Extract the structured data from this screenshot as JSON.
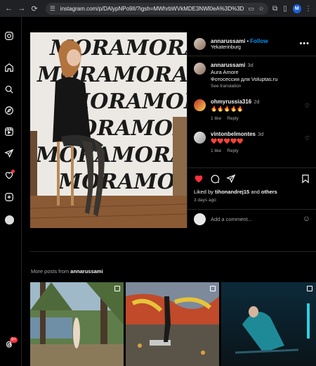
{
  "browser": {
    "url": "instagram.com/p/DAlypNPo9Il/?igsh=MWhrbWVkMDE3NWl0eA%3D%3D",
    "profile_initial": "M"
  },
  "post": {
    "username": "annarussami",
    "follow_label": "Follow",
    "separator": "•",
    "location": "Yekaterinburg",
    "photo_text": "MORAMORA",
    "caption": {
      "username": "annarussami",
      "time": "3d",
      "lines": [
        "Aura Amore",
        "Фотосессия для Voluptas.ru"
      ],
      "see_translation": "See translation"
    },
    "comments": [
      {
        "username": "ohmyrussia316",
        "time": "2d",
        "text": "🔥🔥🔥🔥🔥",
        "likes": "1 like",
        "reply": "Reply"
      },
      {
        "username": "vintonbelmontes",
        "time": "3d",
        "text": "❤️❤️❤️❤️❤️",
        "likes": "1 like",
        "reply": "Reply"
      }
    ],
    "liked_by_prefix": "Liked by",
    "liked_by_user": "tihonandrej15",
    "liked_by_and": "and",
    "liked_by_others": "others",
    "posted_ago": "3 days ago",
    "comment_placeholder": "Add a comment..."
  },
  "more_posts": {
    "prefix": "More posts from",
    "username": "annarussami"
  },
  "sidebar": {
    "notification_badge": "9+"
  },
  "colors": {
    "accent_blue": "#0095f6",
    "like_red": "#ff3040",
    "background": "#000000",
    "chrome": "#202124"
  }
}
